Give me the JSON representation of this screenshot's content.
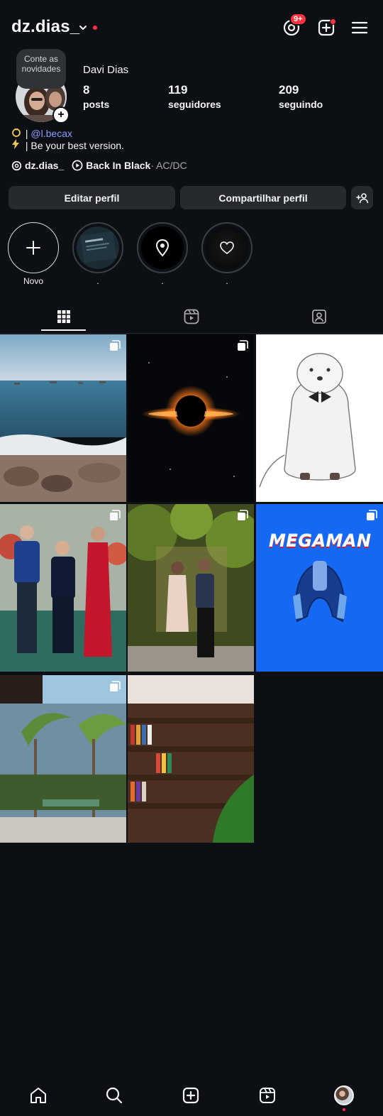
{
  "header": {
    "username": "dz.dias_",
    "notification_badge": "9+"
  },
  "profile": {
    "note": "Conte as novidades",
    "display_name": "Davi Dias",
    "stats": [
      {
        "value": "8",
        "label": "posts"
      },
      {
        "value": "119",
        "label": "seguidores"
      },
      {
        "value": "209",
        "label": "seguindo"
      }
    ],
    "bio": {
      "line1_prefix": " | ",
      "line1_mention": "@l.becax",
      "line2": " | Be your best version."
    },
    "threads_handle": "dz.dias_",
    "music_title": "Back In Black",
    "music_artist": " · AC/DC"
  },
  "buttons": {
    "edit_profile": "Editar perfil",
    "share_profile": "Compartilhar perfil"
  },
  "highlights": [
    {
      "label": "Novo"
    },
    {
      "label": "."
    },
    {
      "label": "."
    },
    {
      "label": "."
    }
  ],
  "colors": {
    "background": "#0c1014",
    "button": "#262a2f",
    "accent_red": "#ff3040",
    "mention": "#8c9cff"
  },
  "grid_posts": [
    {
      "subject": "beach",
      "multi": true
    },
    {
      "subject": "black-hole",
      "multi": true
    },
    {
      "subject": "white-seal-drawing",
      "multi": false
    },
    {
      "subject": "family-photo",
      "multi": true
    },
    {
      "subject": "couple-garden",
      "multi": true
    },
    {
      "subject": "megaman",
      "multi": true,
      "title_text": "MEGAMAN"
    },
    {
      "subject": "palm-trees",
      "multi": true
    },
    {
      "subject": "bookstore",
      "multi": false
    }
  ]
}
